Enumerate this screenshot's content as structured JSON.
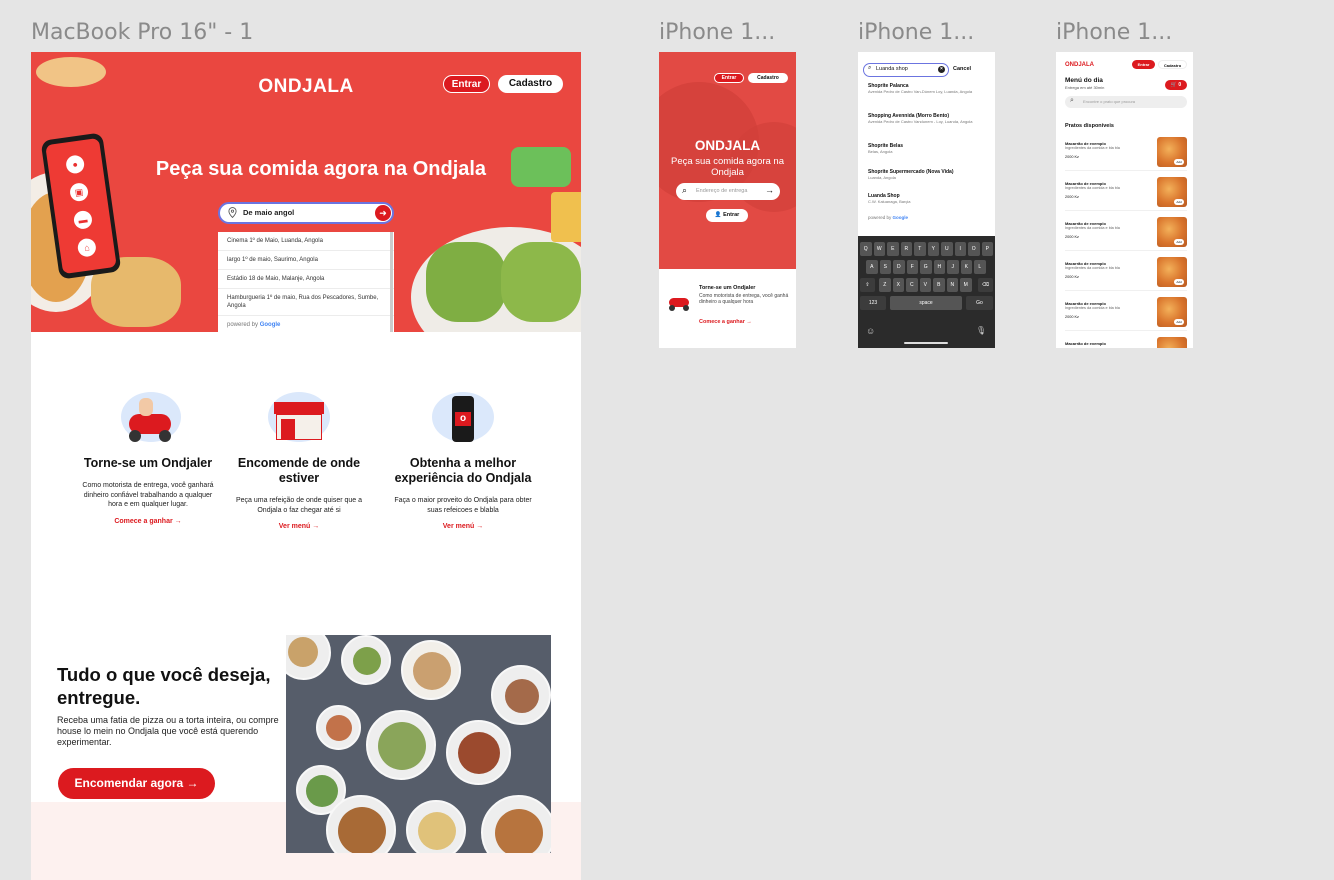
{
  "frames": {
    "desktop": "MacBook Pro 16\" - 1",
    "iphone1": "iPhone 1...",
    "iphone2": "iPhone 1...",
    "iphone3": "iPhone 1..."
  },
  "colors": {
    "brand_red": "#dc1a1f",
    "hero_red": "#ea4740",
    "canvas": "#e5e5e5"
  },
  "desktop": {
    "logo": "ONDJALA",
    "entrar": "Entrar",
    "cadastro": "Cadastro",
    "headline": "Peça sua comida agora na Ondjala",
    "search_value": "De maio angol",
    "suggestions": [
      "Cinema 1º de Maio, Luanda, Angola",
      "largo 1º de maio, Saurimo, Angola",
      "Estádio 18 de Maio, Malanje, Angola",
      "Hamburgueria 1º de maio, Rua dos Pescadores, Sumbe, Angola"
    ],
    "powered_by": "powered by",
    "google": "Google",
    "features": [
      {
        "title": "Torne-se um Ondjaler",
        "text": "Como motorista de entrega, você ganhará dinheiro confiável trabalhando a qualquer hora e em qualquer lugar.",
        "link": "Comece a ganhar →"
      },
      {
        "title": "Encomende de onde estiver",
        "text": "Peça uma refeição de onde quiser que a Ondjala o faz chegar até si",
        "link": "Ver menú →"
      },
      {
        "title": "Obtenha a melhor experiência do Ondjala",
        "text": "Faça o maior proveito do Ondjala para obter suas refeicoes e blabla",
        "link": "Ver menú →"
      }
    ],
    "tudo_title": "Tudo o que você deseja, entregue.",
    "tudo_text": "Receba uma fatia de pizza ou a torta inteira, ou compre house lo mein no Ondjala que você está querendo experimentar.",
    "order_button": "Encomendar agora →"
  },
  "iphone1": {
    "entrar": "Entrar",
    "cadastro": "Cadastro",
    "logo": "ONDJALA",
    "headline": "Peça sua comida agora na Ondjala",
    "search_placeholder": "Endereço de entrega",
    "entrar_button": "Entrar",
    "card_title": "Torne-se um Ondjaler",
    "card_text": "Como motorista de entrega, você ganhá dinheiro a qualquer hora",
    "card_link": "Comece a ganhar →"
  },
  "iphone2": {
    "search_value": "Luanda shop",
    "cancel": "Cancel",
    "results": [
      {
        "name": "Shoprite Palanca",
        "addr": "Avenida Pedro de Castro Van-Dúnem Loy, Luanda, Angola"
      },
      {
        "name": "Shopping Avennida (Morro Bento)",
        "addr": "Avenida Pedro de Castro Vandunem - Loy, Luanda, Angola"
      },
      {
        "name": "Shoprite Belas",
        "addr": "Belas, Angola"
      },
      {
        "name": "Shoprite Supermercado (Nova Vida)",
        "addr": "Luanda, Angola"
      },
      {
        "name": "Luanda Shop",
        "addr": "C.W. Kaluanaga, Barçia"
      }
    ],
    "powered_by": "powered by",
    "google": "Google",
    "keyboard": {
      "row1": [
        "Q",
        "W",
        "E",
        "R",
        "T",
        "Y",
        "U",
        "I",
        "O",
        "P"
      ],
      "row2": [
        "A",
        "S",
        "D",
        "F",
        "G",
        "H",
        "J",
        "K",
        "L"
      ],
      "row3": [
        "Z",
        "X",
        "C",
        "V",
        "B",
        "N",
        "M"
      ],
      "num": "123",
      "space": "space",
      "go": "Go"
    }
  },
  "iphone3": {
    "logo": "ONDJALA",
    "entrar": "Entrar",
    "cadastro": "Cadastro",
    "menu_title": "Menú do dia",
    "delivery": "Entrega em até 30min",
    "cart": "0",
    "search_placeholder": "Encontre o prato que procura",
    "section": "Pratos disponíveis",
    "dishes": [
      {
        "name": "Macarrão de exemplo",
        "desc": "Ingredientes da comida e bla bla",
        "price": "2000 Kz"
      },
      {
        "name": "Macarrão de exemplo",
        "desc": "Ingredientes da comida e bla bla",
        "price": "2000 Kz"
      },
      {
        "name": "Macarrão de exemplo",
        "desc": "Ingredientes da comida e bla bla",
        "price": "2000 Kz"
      },
      {
        "name": "Macarrão de exemplo",
        "desc": "Ingredientes da comida e bla bla",
        "price": "2000 Kz"
      },
      {
        "name": "Macarrão de exemplo",
        "desc": "Ingredientes da comida e bla bla",
        "price": "2000 Kz"
      },
      {
        "name": "Macarrão de exemplo",
        "desc": "",
        "price": ""
      }
    ],
    "add_label": "Add"
  }
}
